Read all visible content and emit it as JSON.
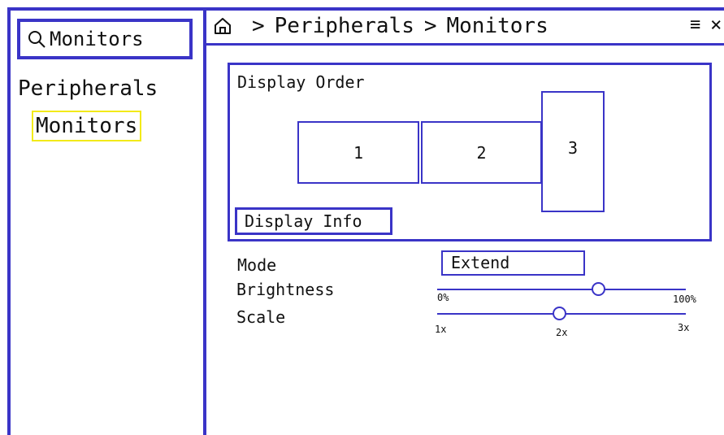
{
  "search": {
    "value": "Monitors",
    "icon": "search-icon"
  },
  "sidebar": {
    "items": [
      {
        "label": "Peripherals",
        "children": [
          {
            "label": "Monitors",
            "selected": true
          }
        ]
      }
    ]
  },
  "breadcrumb": {
    "home_icon": "home-icon",
    "separator": ">",
    "items": [
      "Peripherals",
      "Monitors"
    ]
  },
  "window_controls": {
    "menu": "≡",
    "close": "×"
  },
  "display_order": {
    "title": "Display Order",
    "monitors": [
      "1",
      "2",
      "3"
    ],
    "info_button": "Display Info"
  },
  "settings": {
    "mode": {
      "label": "Mode",
      "value": "Extend"
    },
    "brightness": {
      "label": "Brightness",
      "min_label": "0%",
      "max_label": "100%",
      "value_fraction": 0.65
    },
    "scale": {
      "label": "Scale",
      "min_label": "1x",
      "mid_label": "2x",
      "max_label": "3x",
      "value": "2x"
    }
  },
  "colors": {
    "accent": "#3a34c7",
    "selection_highlight": "#f2ea19"
  }
}
